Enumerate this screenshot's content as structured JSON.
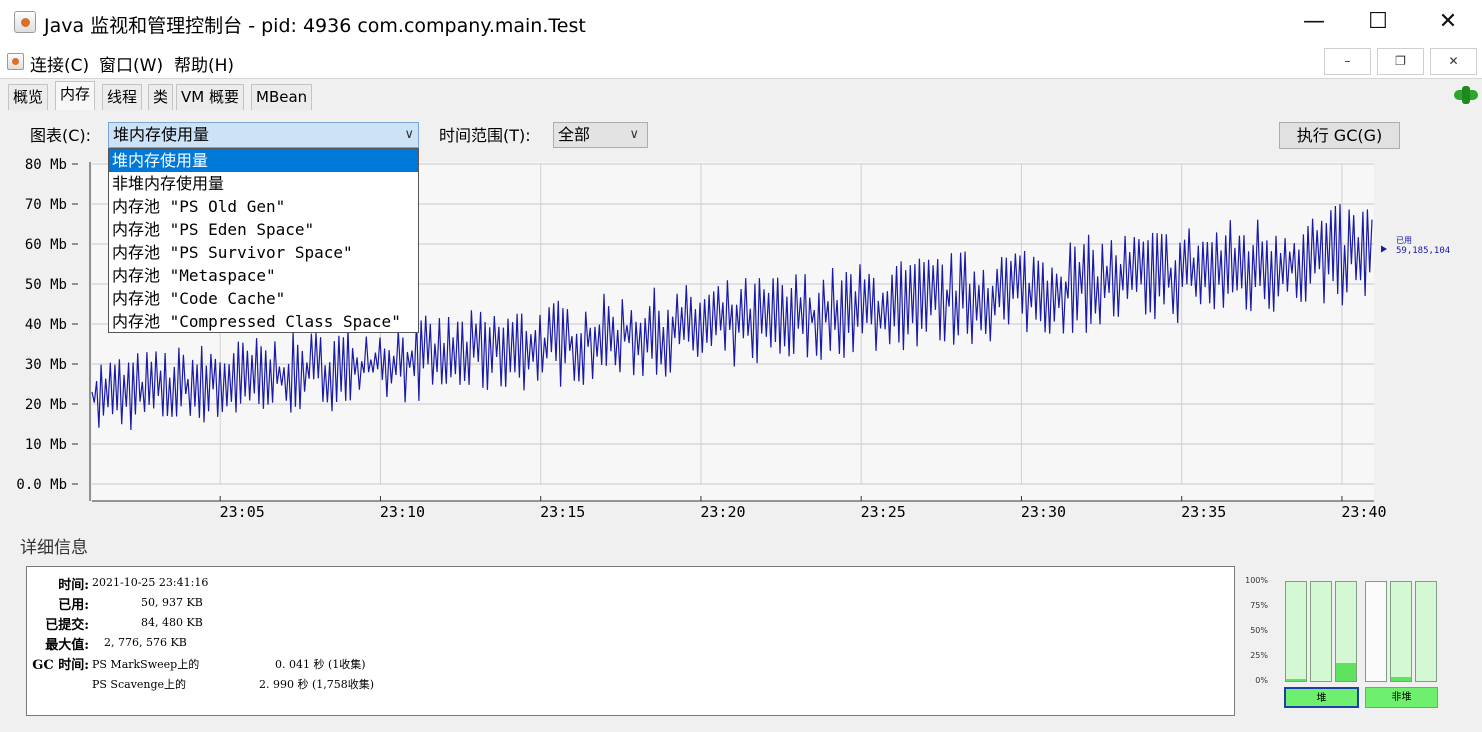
{
  "window": {
    "title": "Java 监视和管理控制台 - pid: 4936 com.company.main.Test",
    "min_glyph": "—",
    "max_glyph": "☐",
    "close_glyph": "✕"
  },
  "menu": {
    "items": [
      "连接(C)",
      "窗口(W)",
      "帮助(H)"
    ],
    "mdi_min": "–",
    "mdi_restore": "❐",
    "mdi_close": "✕"
  },
  "tabs": [
    {
      "label": "概览",
      "active": false
    },
    {
      "label": "内存",
      "active": true
    },
    {
      "label": "线程",
      "active": false
    },
    {
      "label": "类",
      "active": false
    },
    {
      "label": "VM 概要",
      "active": false
    },
    {
      "label": "MBean",
      "active": false
    }
  ],
  "controls": {
    "chart_label": "图表(C):",
    "chart_selected": "堆内存使用量",
    "range_label": "时间范围(T):",
    "range_selected": "全部",
    "gc_button": "执行 GC(G)",
    "combo_arrow": "∨"
  },
  "dropdown": {
    "options": [
      "堆内存使用量",
      "非堆内存使用量",
      "内存池 \"PS Old Gen\"",
      "内存池 \"PS Eden Space\"",
      "内存池 \"PS Survivor Space\"",
      "内存池 \"Metaspace\"",
      "内存池 \"Code Cache\"",
      "内存池 \"Compressed Class Space\""
    ],
    "selected_index": 0
  },
  "chart_data": {
    "type": "line",
    "title": "",
    "xlabel": "",
    "ylabel": "",
    "y_ticks": [
      "0.0 Mb",
      "10 Mb",
      "20 Mb",
      "30 Mb",
      "40 Mb",
      "50 Mb",
      "60 Mb",
      "70 Mb",
      "80 Mb"
    ],
    "ylim": [
      0,
      80
    ],
    "x_ticks": [
      "23:05",
      "23:10",
      "23:15",
      "23:20",
      "23:25",
      "23:30",
      "23:35",
      "23:40"
    ],
    "xlim": [
      "23:01",
      "23:41"
    ],
    "grid": true,
    "series": [
      {
        "name": "已用",
        "color": "#1a1aa8",
        "trend_start_mb": 14,
        "trend_end_mb": 48,
        "min_start_mb": 12,
        "min_end_mb": 45,
        "max_start_mb": 32,
        "max_end_mb": 71,
        "current_value": "59,185,104"
      }
    ]
  },
  "details": {
    "title": "详细信息",
    "labels": {
      "time": "时间:",
      "used": "已用:",
      "committed": "已提交:",
      "max": "最大值:",
      "gc_time": "GC 时间:"
    },
    "values": {
      "time": "2021-10-25 23:41:16",
      "used": "50, 937 KB",
      "committed": "84, 480 KB",
      "max": "2, 776, 576 KB",
      "gc1_name": "PS MarkSweep上的",
      "gc1_value": "0. 041  秒 (1收集)",
      "gc2_name": "PS Scavenge上的",
      "gc2_value": "2. 990  秒 (1,758收集)"
    }
  },
  "pools": {
    "pct_labels": [
      "100%",
      "75%",
      "50%",
      "25%",
      "0%"
    ],
    "heap_label": "堆",
    "nonheap_label": "非堆",
    "heap_fills": [
      0.02,
      0.0,
      0.18
    ],
    "nonheap_fills": [
      0.0,
      0.04,
      0.0
    ]
  }
}
